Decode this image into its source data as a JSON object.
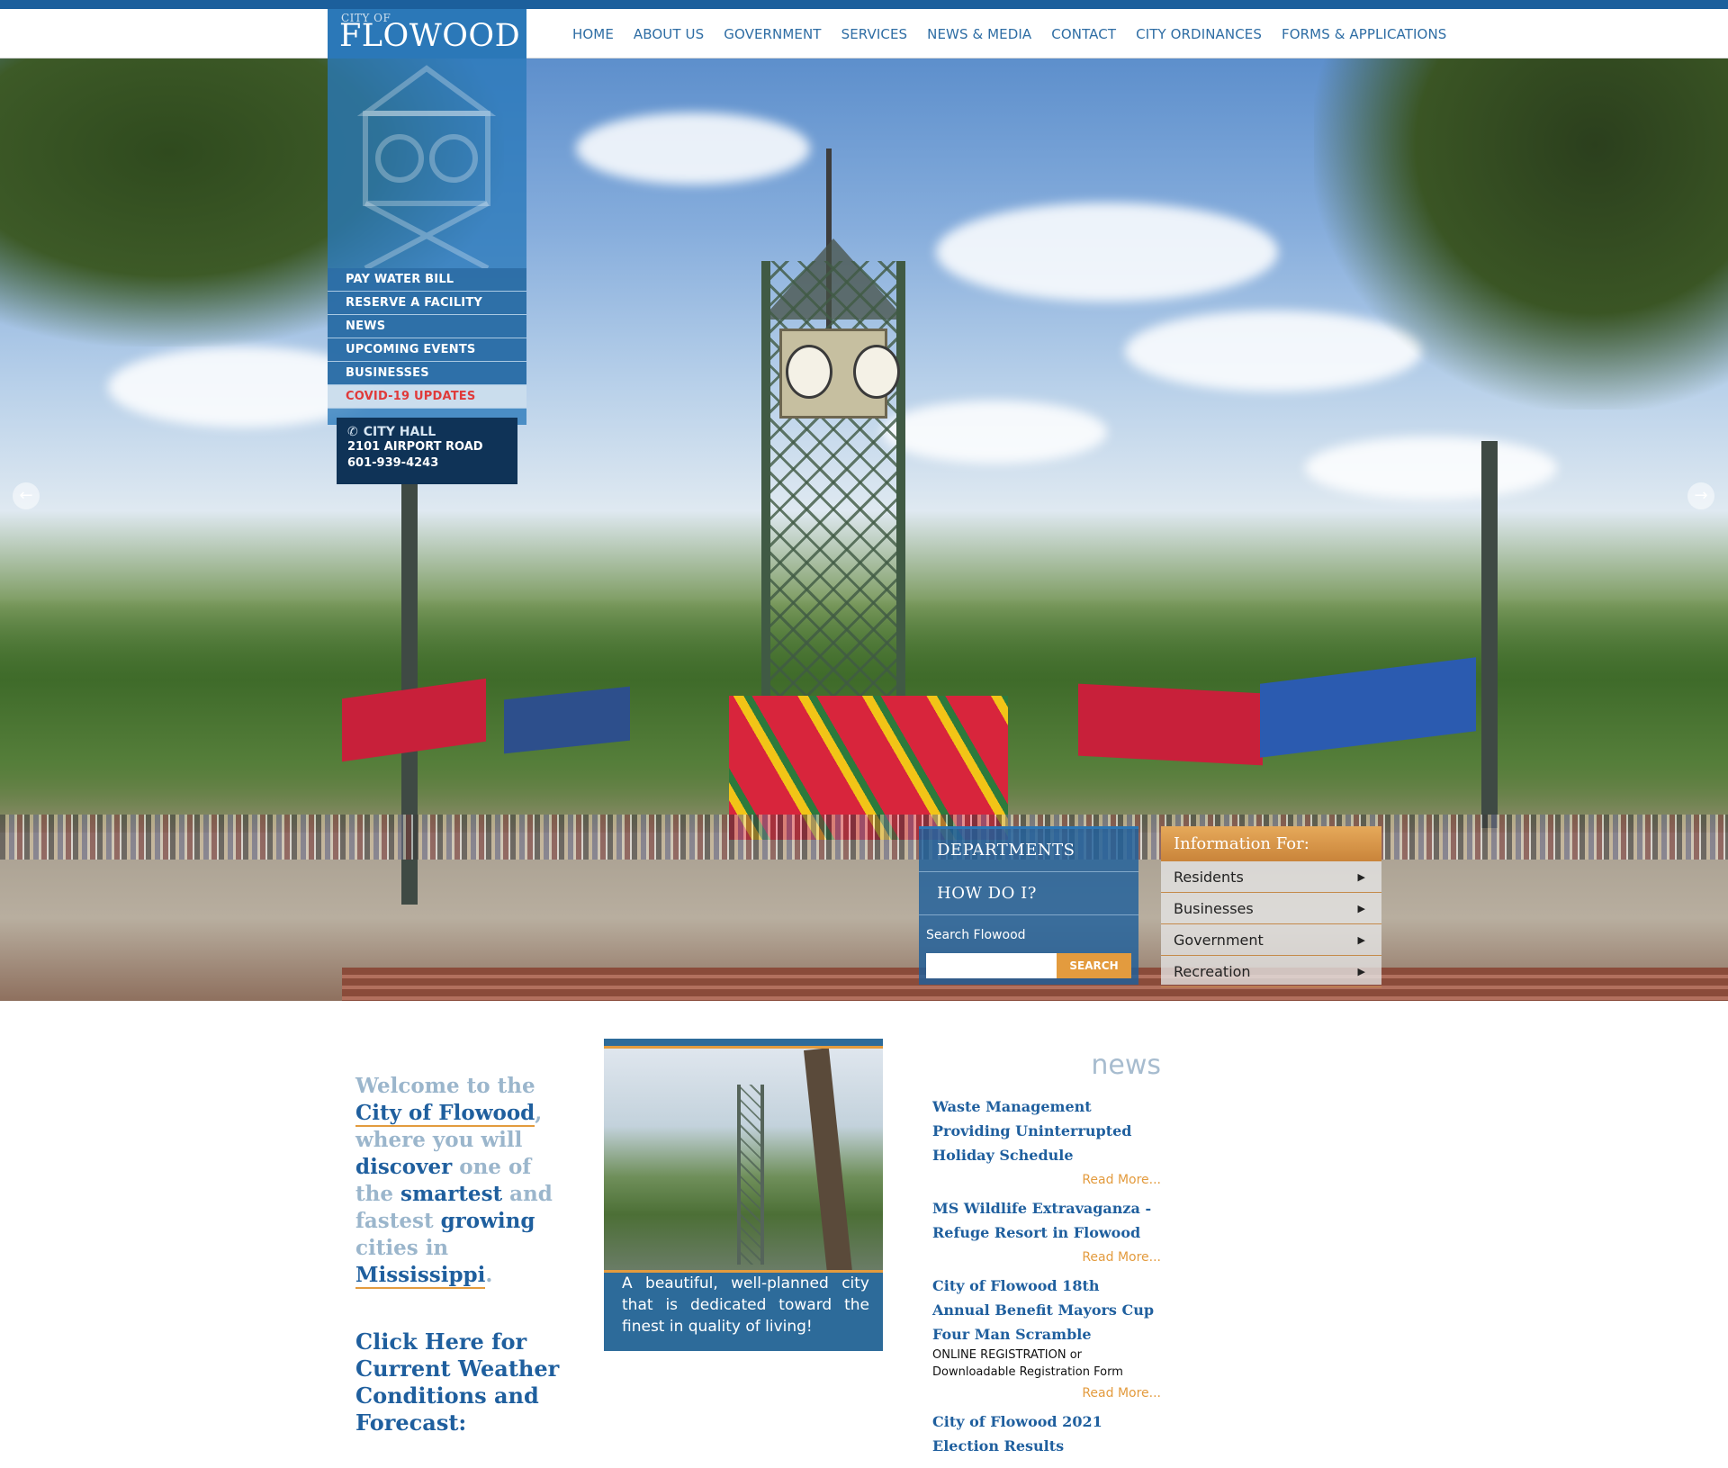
{
  "logo": {
    "small": "CITY OF",
    "big": "FLOWOOD"
  },
  "nav": [
    "HOME",
    "ABOUT US",
    "GOVERNMENT",
    "SERVICES",
    "NEWS & MEDIA",
    "CONTACT",
    "CITY ORDINANCES",
    "FORMS & APPLICATIONS"
  ],
  "quick_links": [
    "PAY WATER BILL",
    "RESERVE A FACILITY",
    "NEWS",
    "UPCOMING EVENTS",
    "BUSINESSES",
    "COVID-19 UPDATES"
  ],
  "city_hall": {
    "title": "CITY HALL",
    "address": "2101 AIRPORT ROAD",
    "phone": "601-939-4243"
  },
  "departments": {
    "items": [
      "DEPARTMENTS",
      "HOW DO I?"
    ],
    "search_label": "Search Flowood",
    "search_button": "SEARCH"
  },
  "info_for": {
    "title": "Information For:",
    "items": [
      "Residents",
      "Businesses",
      "Government",
      "Recreation"
    ]
  },
  "welcome": {
    "p1": "Welcome to the",
    "city": "City of Flowood",
    "p2": ", where you will",
    "discover": "discover",
    "p3": " one of the ",
    "smartest": "smartest",
    "p4": " and fastest ",
    "growing": "growing",
    "p5": " cities in",
    "ms": "Mississippi",
    "p6": "."
  },
  "weather_link": "Click Here for Current Weather Conditions and Forecast:",
  "photo_caption": "A beautiful, well-planned city that is dedicated toward the finest in quality of living!",
  "news": {
    "heading": "news",
    "items": [
      {
        "title": "Waste Management Providing Uninterrupted Holiday Schedule",
        "desc": "",
        "more": "Read More..."
      },
      {
        "title": "MS Wildlife Extravaganza - Refuge Resort in Flowood",
        "desc": "",
        "more": "Read More..."
      },
      {
        "title": "City of Flowood 18th Annual Benefit Mayors Cup Four Man Scramble",
        "desc": "ONLINE REGISTRATION or Downloadable Registration Form",
        "more": "Read More..."
      },
      {
        "title": "City of Flowood 2021 Election Results",
        "desc": "",
        "more": ""
      }
    ]
  },
  "icons": {
    "phone": "phone-icon",
    "prev": "arrow-left-icon",
    "next": "arrow-right-icon"
  },
  "colors": {
    "brand_blue": "#1c5f9c",
    "accent_orange": "#e39b3e",
    "covid_red": "#e03a3a"
  }
}
